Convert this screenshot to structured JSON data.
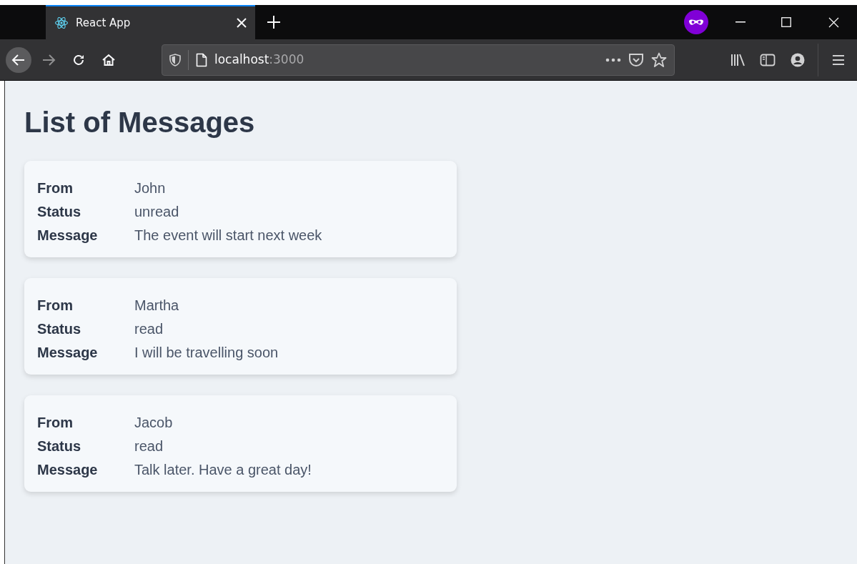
{
  "browser": {
    "tab": {
      "title": "React App",
      "selected": true
    },
    "url": {
      "host": "localhost",
      "port": ":3000"
    }
  },
  "heading": "List of Messages",
  "messages": [
    {
      "fields": [
        {
          "label": "From",
          "value": "John"
        },
        {
          "label": "Status",
          "value": "unread"
        },
        {
          "label": "Message",
          "value": "The event will start next week"
        }
      ]
    },
    {
      "fields": [
        {
          "label": "From",
          "value": "Martha"
        },
        {
          "label": "Status",
          "value": "read"
        },
        {
          "label": "Message",
          "value": "I will be travelling soon"
        }
      ]
    },
    {
      "fields": [
        {
          "label": "From",
          "value": "Jacob"
        },
        {
          "label": "Status",
          "value": "read"
        },
        {
          "label": "Message",
          "value": "Talk later. Have a great day!"
        }
      ]
    }
  ]
}
